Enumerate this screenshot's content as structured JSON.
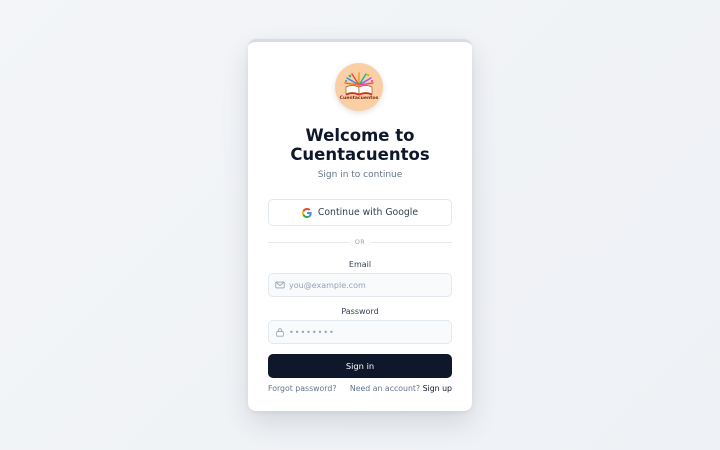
{
  "logo": {
    "text": "Cuentacuentos",
    "icon": "book-logo-icon",
    "bg_color": "#fbcfa6"
  },
  "heading": {
    "title": "Welcome to Cuentacuentos",
    "subtitle": "Sign in to continue"
  },
  "google": {
    "label": "Continue with Google",
    "icon": "google-icon"
  },
  "divider": {
    "text": "OR"
  },
  "email": {
    "label": "Email",
    "placeholder": "you@example.com",
    "icon": "mail-icon"
  },
  "password": {
    "label": "Password",
    "placeholder": "••••••••",
    "icon": "lock-icon"
  },
  "signin": {
    "label": "Sign in",
    "bg_color": "#0f172a"
  },
  "footer": {
    "forgot": "Forgot password?",
    "need_account": "Need an account?",
    "signup": "Sign up"
  }
}
